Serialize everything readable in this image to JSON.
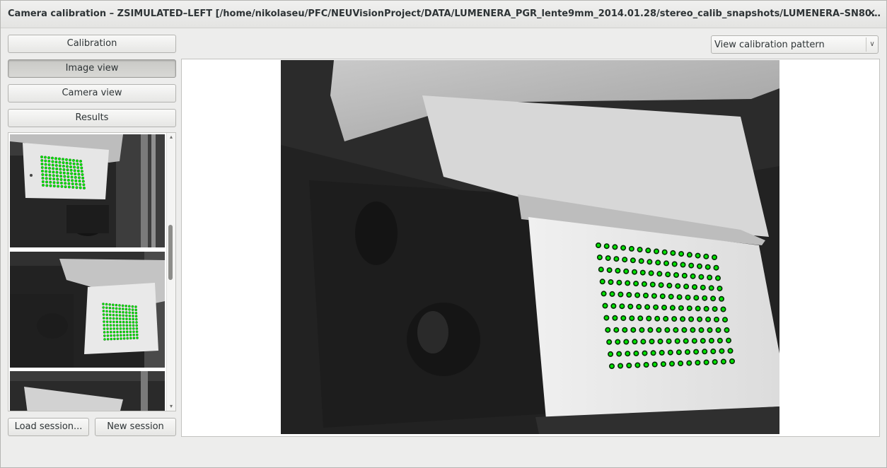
{
  "window": {
    "title": "Camera calibration – ZSIMULATED–LEFT [/home/nikolaseu/PFC/NEUVisionProject/DATA/LUMENERA_PGR_lente9mm_2014.01.28/stereo_calib_snapshots/LUMENERA–SN80…",
    "close_glyph": "✕"
  },
  "sidebar": {
    "buttons": [
      {
        "label": "Calibration",
        "active": false
      },
      {
        "label": "Image view",
        "active": true
      },
      {
        "label": "Camera view",
        "active": false
      },
      {
        "label": "Results",
        "active": false
      }
    ],
    "load_session_label": "Load session...",
    "new_session_label": "New session",
    "scroll_up_glyph": "▴",
    "scroll_down_glyph": "▾"
  },
  "toolbar": {
    "view_select": {
      "selected": "View calibration pattern",
      "arrow_glyph": "∨"
    }
  },
  "colors": {
    "pattern_dot": "#00e600",
    "pattern_dot_outline": "#003300"
  }
}
